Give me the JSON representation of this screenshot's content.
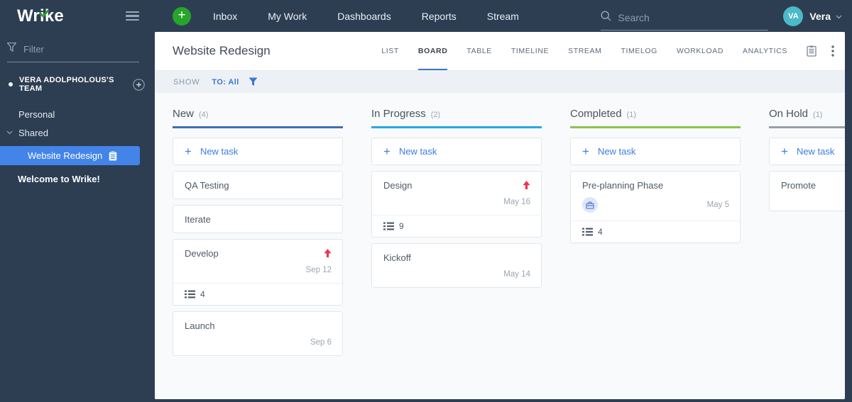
{
  "navbar": {
    "logo": "Wrike",
    "items": [
      {
        "label": "Inbox"
      },
      {
        "label": "My Work"
      },
      {
        "label": "Dashboards"
      },
      {
        "label": "Reports"
      },
      {
        "label": "Stream"
      }
    ],
    "search_placeholder": "Search",
    "user": {
      "initials": "VA",
      "name": "Vera"
    }
  },
  "sidebar": {
    "filter_placeholder": "Filter",
    "team": {
      "name": "VERA ADOLPHOLOUS'S TEAM"
    },
    "items": [
      {
        "label": "Personal"
      },
      {
        "label": "Shared"
      },
      {
        "label": "Website Redesign",
        "selected": true
      },
      {
        "label": "Welcome to Wrike!"
      }
    ]
  },
  "header": {
    "title": "Website Redesign",
    "tabs": [
      {
        "label": "LIST"
      },
      {
        "label": "BOARD",
        "active": true
      },
      {
        "label": "TABLE"
      },
      {
        "label": "TIMELINE"
      },
      {
        "label": "STREAM"
      },
      {
        "label": "TIMELOG"
      },
      {
        "label": "WORKLOAD"
      },
      {
        "label": "ANALYTICS"
      }
    ]
  },
  "filter_bar": {
    "show_label": "SHOW",
    "to_label": "TO: All"
  },
  "board": {
    "columns": [
      {
        "name": "New",
        "count": "(4)",
        "accent": "#3d6eb5",
        "new_task_label": "New task",
        "cards": [
          {
            "title": "QA Testing"
          },
          {
            "title": "Iterate"
          },
          {
            "title": "Develop",
            "priority": true,
            "date": "Sep 12",
            "subtasks": "4"
          },
          {
            "title": "Launch",
            "date": "Sep 6"
          }
        ]
      },
      {
        "name": "In Progress",
        "count": "(2)",
        "accent": "#27a8e0",
        "new_task_label": "New task",
        "cards": [
          {
            "title": "Design",
            "priority": true,
            "date": "May 16",
            "subtasks": "9"
          },
          {
            "title": "Kickoff",
            "date": "May 14"
          }
        ]
      },
      {
        "name": "Completed",
        "count": "(1)",
        "accent": "#8bc34a",
        "new_task_label": "New task",
        "cards": [
          {
            "title": "Pre-planning Phase",
            "badge": "briefcase-icon",
            "date": "May 5",
            "subtasks": "4"
          }
        ]
      },
      {
        "name": "On Hold",
        "count": "(1)",
        "accent": "#9aa0a6",
        "new_task_label": "New task",
        "cards": [
          {
            "title": "Promote",
            "tall": true
          }
        ]
      }
    ]
  },
  "colors": {
    "chrome_navy": "#2d3e53",
    "selected_item_blue": "#4384e8",
    "link_blue": "#3c7de2",
    "priority_red": "#e8384f",
    "avatar_teal": "#4cbac7",
    "plus_green": "#27a42a"
  }
}
